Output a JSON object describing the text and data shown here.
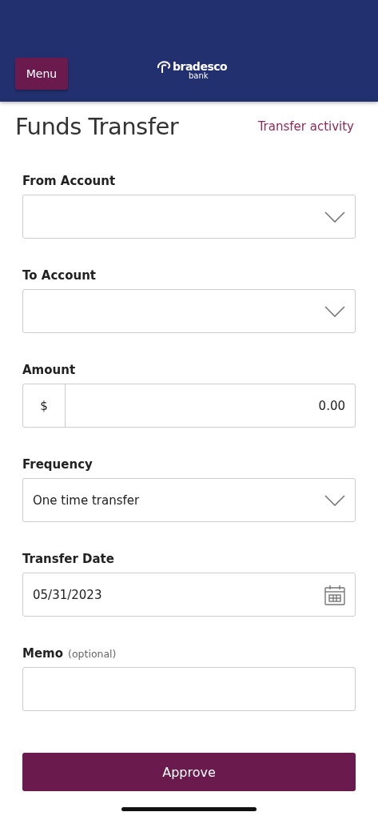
{
  "header": {
    "menu_button": "Menu",
    "logo": {
      "name": "bradesco",
      "sub": "bank"
    }
  },
  "title": "Funds Transfer",
  "activity_link": "Transfer activity",
  "fields": [
    {
      "kind": "select",
      "label": "From Account"
    },
    {
      "kind": "select",
      "label": "To Account"
    },
    {
      "kind": "amount",
      "label": "Amount",
      "prefix": "$",
      "value": "0.00"
    },
    {
      "kind": "select",
      "label": "Frequency",
      "value": "One time transfer"
    },
    {
      "kind": "date",
      "label": "Transfer Date",
      "value": "05/31/2023"
    },
    {
      "kind": "text",
      "label": "Memo",
      "hint": "(optional)"
    }
  ],
  "approve_button": "Approve"
}
